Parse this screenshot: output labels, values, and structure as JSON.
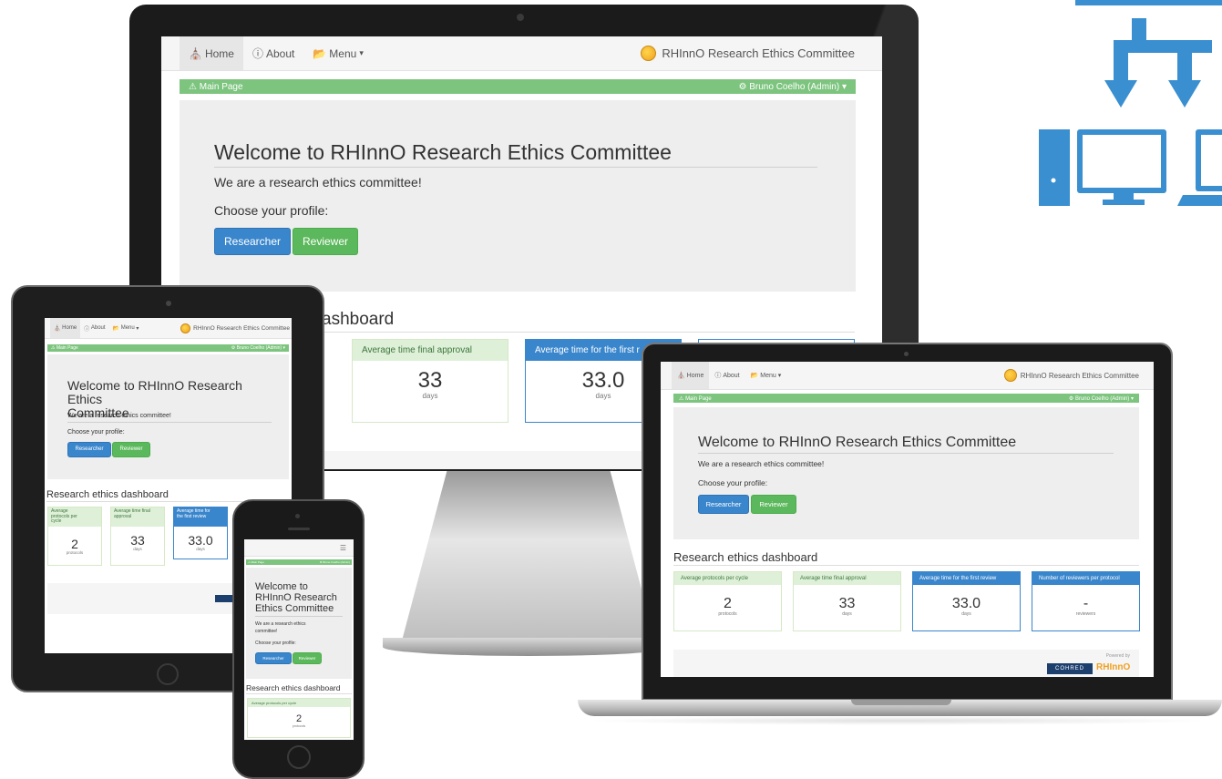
{
  "app": {
    "nav": {
      "home": "Home",
      "about": "About",
      "menu": "Menu"
    },
    "brand": "RHInnO Research Ethics Committee",
    "breadcrumb": "Main Page",
    "user": "Bruno Coelho (Admin)",
    "welcome_title": "Welcome to RHInnO Research Ethics Committee",
    "welcome_mobile_lines": [
      "Welcome to",
      "RHInnO Research",
      "Ethics Committee"
    ],
    "tablet_title_lines": [
      "Welcome to RHInnO Research Ethics",
      "Committee"
    ],
    "tagline": "We are a research ethics committee!",
    "mobile_tagline_lines": [
      "We are a research ethics",
      "committee!"
    ],
    "choose_profile": "Choose your profile:",
    "btn_researcher": "Researcher",
    "btn_reviewer": "Reviewer",
    "dashboard_title": "Research ethics dashboard",
    "monitor_dashboard_fragment": "ashboard",
    "cards": {
      "protocols": {
        "title": "Average protocols per cycle",
        "value": "2",
        "unit": "protocols"
      },
      "final_approval": {
        "title": "Average time final approval",
        "value": "33",
        "unit": "days"
      },
      "first_review": {
        "title": "Average time for the first review",
        "value": "33.0",
        "unit": "days"
      },
      "first_review_short": "Average time for the first r",
      "reviewers": {
        "title": "Number of reviewers per protocol",
        "value": "-",
        "unit": "reviewers"
      }
    },
    "tablet_card_titles": {
      "protocols": [
        "Average",
        "protocols per",
        "cycle"
      ],
      "final_approval": [
        "Average time final",
        "approval"
      ],
      "first_review": [
        "Average time for",
        "the first review"
      ]
    },
    "powered_by": "Powered by",
    "cohred": "COHRED",
    "rhinno_logo": "RHInnO"
  },
  "colors": {
    "green": "#7dc47f",
    "blue": "#3a86cc",
    "accent": "#3a8fd0"
  },
  "icons": [
    "home-icon",
    "info-icon",
    "folder-icon",
    "caret-down-icon",
    "gear-icon",
    "warning-icon",
    "hamburger-icon",
    "logo-icon"
  ]
}
